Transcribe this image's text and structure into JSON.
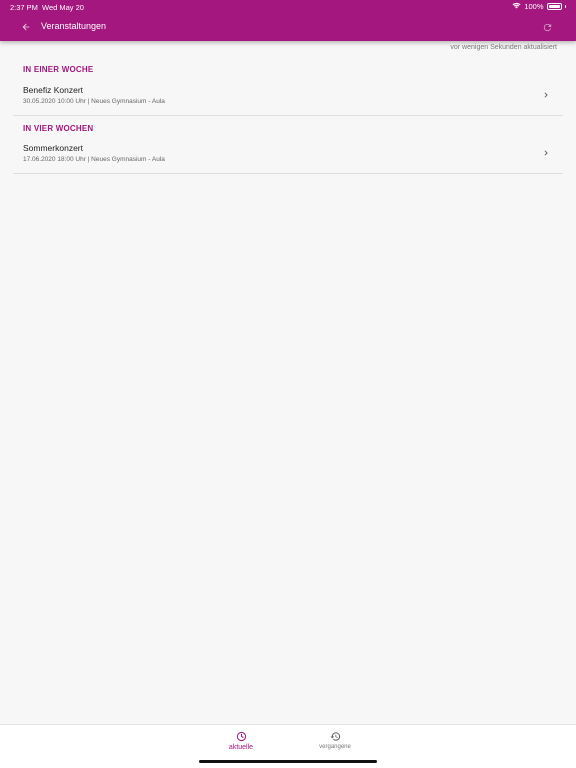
{
  "status_bar": {
    "time": "2:37 PM",
    "date": "Wed May 20",
    "battery_percent": "100%"
  },
  "app_bar": {
    "title": "Veranstaltungen",
    "back_icon": "arrow-left-icon",
    "refresh_icon": "refresh-icon",
    "background_color": "#a4177f"
  },
  "updated_note": "vor wenigen Sekunden aktualisiert",
  "sections": [
    {
      "header": "IN EINER WOCHE",
      "events": [
        {
          "title": "Benefiz Konzert",
          "details": "30.05.2020 10:00 Uhr | Neues Gymnasium - Aula"
        }
      ]
    },
    {
      "header": "IN VIER WOCHEN",
      "events": [
        {
          "title": "Sommerkonzert",
          "details": "17.06.2020 18:00 Uhr | Neues Gymnasium - Aula"
        }
      ]
    }
  ],
  "bottom_nav": {
    "tabs": [
      {
        "label": "aktuelle",
        "icon": "clock-icon",
        "active": true
      },
      {
        "label": "vergangene",
        "icon": "history-icon",
        "active": false
      }
    ],
    "accent_color": "#a4177f"
  }
}
